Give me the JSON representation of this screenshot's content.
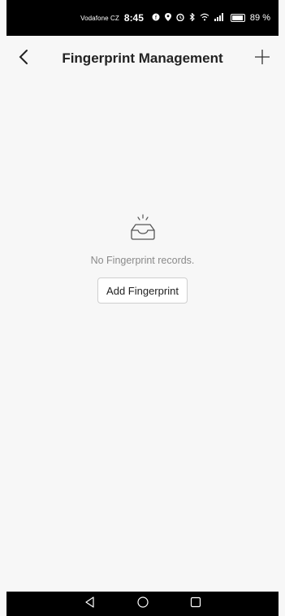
{
  "status_bar": {
    "carrier": "Vodafone CZ",
    "time": "8:45",
    "battery_text": "89 %",
    "icons": [
      "facebook-icon",
      "location-icon",
      "alarm-icon",
      "bluetooth-icon",
      "wifi-icon",
      "signal-icon",
      "battery-icon"
    ]
  },
  "header": {
    "title": "Fingerprint Management",
    "back_icon": "chevron-left-icon",
    "add_icon": "plus-icon"
  },
  "empty_state": {
    "icon": "empty-tray-icon",
    "message": "No Fingerprint records.",
    "button_label": "Add Fingerprint"
  },
  "nav_bar": {
    "icons": [
      "back-triangle-icon",
      "home-circle-icon",
      "recents-square-icon"
    ]
  },
  "colors": {
    "background": "#f7f7f7",
    "text_primary": "#222222",
    "text_secondary": "#8a8a8a",
    "system_bars": "#000000"
  }
}
